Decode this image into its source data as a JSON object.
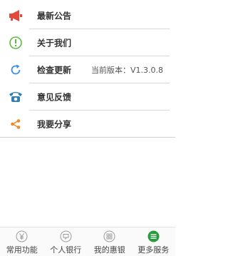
{
  "menu": {
    "items": [
      {
        "label": "最新公告",
        "icon": "megaphone-icon"
      },
      {
        "label": "关于我们",
        "icon": "info-icon"
      },
      {
        "label": "检查更新",
        "icon": "refresh-icon",
        "value": "当前版本：V1.3.0.8"
      },
      {
        "label": "意见反馈",
        "icon": "phone-icon"
      },
      {
        "label": "我要分享",
        "icon": "share-icon"
      }
    ]
  },
  "tabbar": {
    "tabs": [
      {
        "label": "常用功能",
        "icon": "yen-icon",
        "active": false
      },
      {
        "label": "个人银行",
        "icon": "chat-icon",
        "active": false
      },
      {
        "label": "我的惠银",
        "icon": "grid-icon",
        "active": false
      },
      {
        "label": "更多服务",
        "icon": "menu-icon",
        "active": true
      }
    ]
  },
  "colors": {
    "megaphone": "#e2493b",
    "info": "#5dbb3f",
    "refresh": "#3d8fe0",
    "phone": "#2e7fb8",
    "share": "#ef8a2a",
    "tab_active": "#2a9a3e",
    "tab_inactive": "#9a9a9a"
  }
}
